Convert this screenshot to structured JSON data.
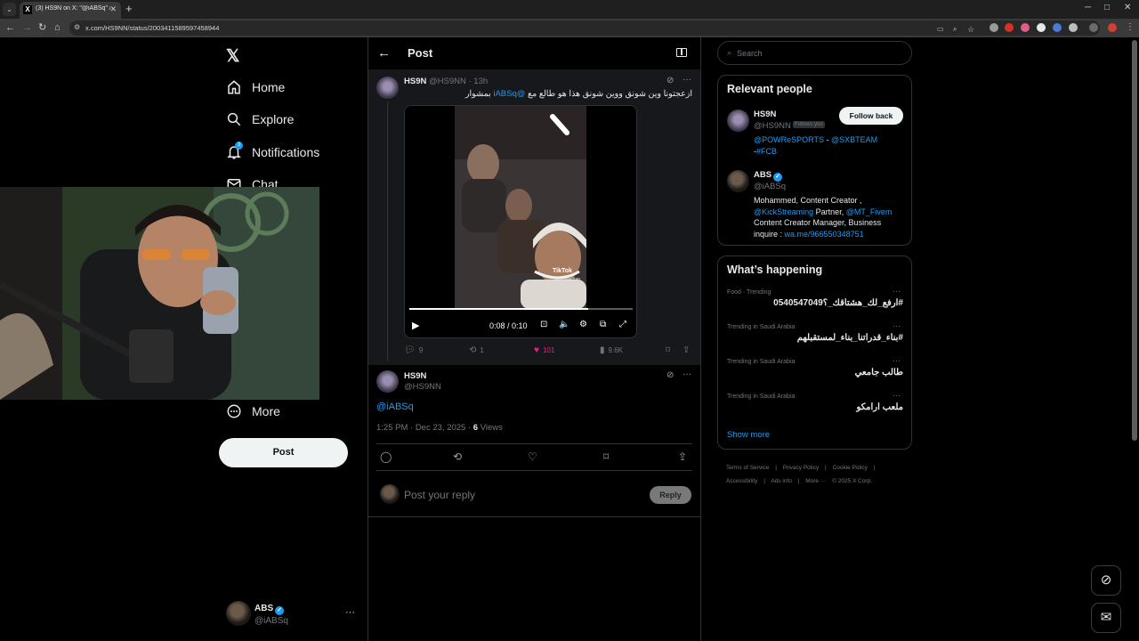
{
  "browser": {
    "tab_title": "(3) HS9N on X: \"@iABSq\" / X",
    "url": "x.com/HS9NN/status/2003411589597458944",
    "tab_close": "✕",
    "new_tab": "+",
    "window_controls": [
      "─",
      "□",
      "✕"
    ]
  },
  "nav": {
    "logo": "𝕏",
    "items": [
      {
        "label": "Home",
        "icon": "home-icon"
      },
      {
        "label": "Explore",
        "icon": "search-icon"
      },
      {
        "label": "Notifications",
        "icon": "bell-icon",
        "badge": "3"
      },
      {
        "label": "Chat",
        "icon": "mail-icon"
      },
      {
        "label": "More",
        "icon": "more-circle-icon"
      }
    ],
    "post_button": "Post",
    "account": {
      "name": "ABS",
      "handle": "@iABSq"
    }
  },
  "header": {
    "title": "Post"
  },
  "quoted_post": {
    "author": "HS9N",
    "handle_time": "@HS9NN · 13h",
    "text_prefix": "ازعجتونا وين شونق ووين شونق هذا هو طالع مع ",
    "mention": "@iABSq",
    "text_suffix": " بمشوار",
    "video": {
      "time": "0:08 / 0:10",
      "progress": 0.8,
      "watermark": "TikTok",
      "watermark_handle": "@onlysulttan"
    },
    "stats": {
      "replies": "9",
      "reposts": "1",
      "likes": "101",
      "views": "9.6K"
    }
  },
  "reply": {
    "author": "HS9N",
    "handle": "@HS9NN",
    "text": "@iABSq",
    "timestamp": "1:25 PM · Dec 23, 2025 · ",
    "views_count": "6",
    "views_label": " Views"
  },
  "reply_box": {
    "placeholder": "Post your reply",
    "button": "Reply"
  },
  "search": {
    "placeholder": "Search"
  },
  "relevant_people": {
    "title": "Relevant people",
    "people": [
      {
        "name": "HS9N",
        "handle": "@HS9NN",
        "follows_you": "Follows you",
        "button": "Follow back",
        "bio_link1": "@POWReSPORTS",
        "bio_text1": " - ",
        "bio_link2": "@SXBTEAM",
        "bio_text2": " -",
        "bio_link3": "#FCB"
      },
      {
        "name": "ABS",
        "handle": "@iABSq",
        "bio_text1": "Mohammed, Content Creator ,",
        "bio_link1": "@KickStreaming",
        "bio_text2": " Partner, ",
        "bio_link2": "@MT_Fivem",
        "bio_text3": "Content Creator Manager, Business inquire : ",
        "bio_link3": "wa.me/966550348751"
      }
    ]
  },
  "whats_happening": {
    "title": "What’s happening",
    "trends": [
      {
        "category": "Food · Trending",
        "name": "#ارفع_لك_هشتاقك_؟0540547049"
      },
      {
        "category": "Trending in Saudi Arabia",
        "name": "#بناء_قدراتنا_بناء_لمستقبلهم"
      },
      {
        "category": "Trending in Saudi Arabia",
        "name": "طالب جامعي"
      },
      {
        "category": "Trending in Saudi Arabia",
        "name": "ملعب ارامكو"
      }
    ],
    "show_more": "Show more"
  },
  "footer": {
    "links": [
      "Terms of Service",
      "|",
      "Privacy Policy",
      "|",
      "Cookie Policy",
      "|",
      "Accessibility",
      "|",
      "Ads info",
      "|",
      "More ···",
      "© 2025 X Corp."
    ]
  },
  "colors": {
    "accent": "#1d9bf0",
    "like": "#f91880",
    "background": "#000000",
    "border": "#2f3336"
  }
}
